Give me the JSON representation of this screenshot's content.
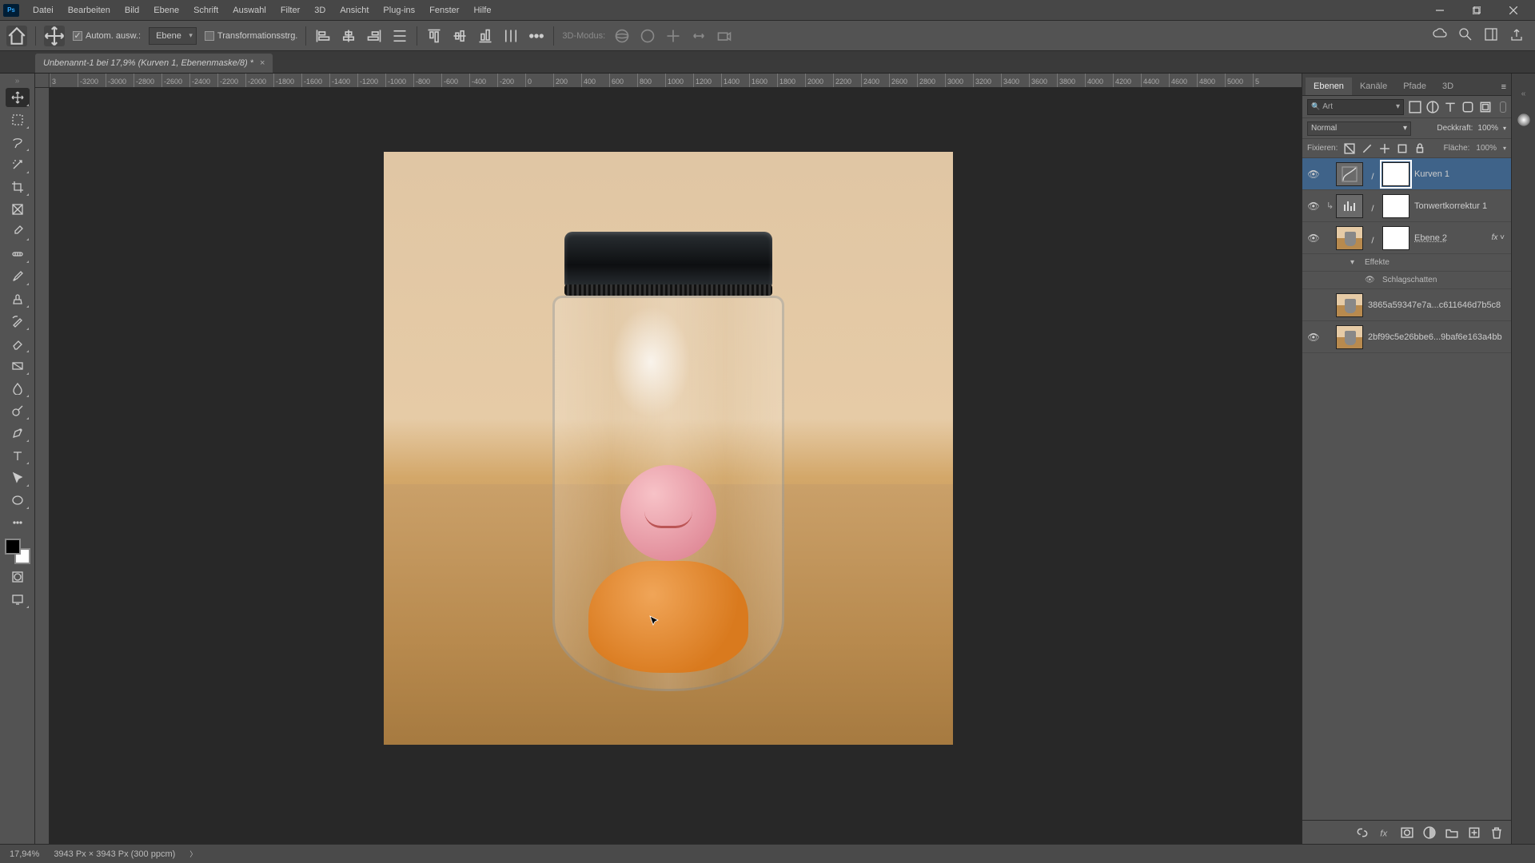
{
  "menu": {
    "items": [
      "Datei",
      "Bearbeiten",
      "Bild",
      "Ebene",
      "Schrift",
      "Auswahl",
      "Filter",
      "3D",
      "Ansicht",
      "Plug-ins",
      "Fenster",
      "Hilfe"
    ]
  },
  "options": {
    "auto_select_label": "Autom. ausw.:",
    "auto_select_value": "Ebene",
    "transform_label": "Transformationsstrg.",
    "mode3d_label": "3D-Modus:"
  },
  "doc_tab": {
    "title": "Unbenannt-1 bei 17,9% (Kurven 1, Ebenenmaske/8) *"
  },
  "ruler_ticks": [
    "3",
    "-3200",
    "-3000",
    "-2800",
    "-2600",
    "-2400",
    "-2200",
    "-2000",
    "-1800",
    "-1600",
    "-1400",
    "-1200",
    "-1000",
    "-800",
    "-600",
    "-400",
    "-200",
    "0",
    "200",
    "400",
    "600",
    "800",
    "1000",
    "1200",
    "1400",
    "1600",
    "1800",
    "2000",
    "2200",
    "2400",
    "2600",
    "2800",
    "3000",
    "3200",
    "3400",
    "3600",
    "3800",
    "4000",
    "4200",
    "4400",
    "4600",
    "4800",
    "5000",
    "5"
  ],
  "panels": {
    "tabs": [
      "Ebenen",
      "Kanäle",
      "Pfade",
      "3D"
    ],
    "search_placeholder": "Art",
    "blend_mode": "Normal",
    "opacity_label": "Deckkraft:",
    "opacity_value": "100%",
    "lock_label": "Fixieren:",
    "fill_label": "Fläche:",
    "fill_value": "100%"
  },
  "layers": [
    {
      "name": "Kurven 1",
      "selected": true,
      "type": "curves"
    },
    {
      "name": "Tonwertkorrektur 1",
      "selected": false,
      "type": "levels"
    },
    {
      "name": "Ebene 2",
      "selected": false,
      "type": "layer",
      "fx": true
    },
    {
      "name": "3865a59347e7a...c611646d7b5c8",
      "selected": false,
      "type": "img",
      "hidden": true
    },
    {
      "name": "2bf99c5e26bbe6...9baf6e163a4bb",
      "selected": false,
      "type": "img"
    }
  ],
  "layer_fx": {
    "effects_label": "Effekte",
    "shadow_label": "Schlagschatten"
  },
  "status": {
    "zoom": "17,94%",
    "doc_info": "3943 Px × 3943 Px (300 ppcm)"
  }
}
